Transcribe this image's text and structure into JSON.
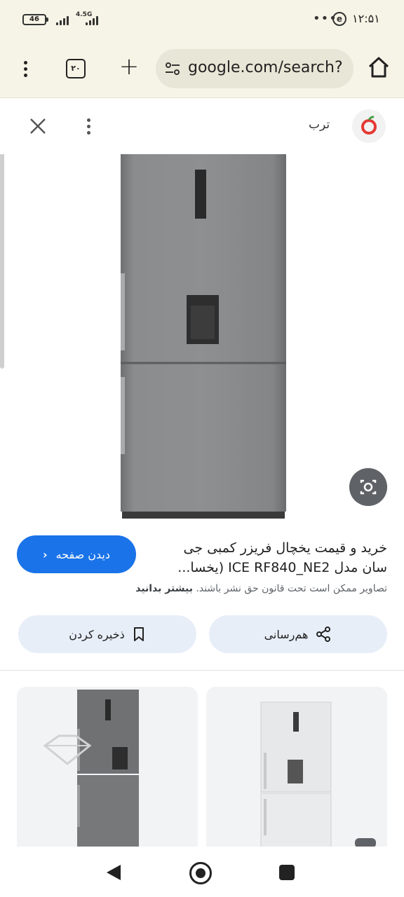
{
  "status_bar": {
    "battery_level": "46",
    "network_type": "4.5G",
    "time": "۱۲:۵۱",
    "overflow_dots": "•••"
  },
  "toolbar": {
    "tab_count": "۲۰",
    "url": "google.com/search?"
  },
  "viewer": {
    "source_name": "ترب"
  },
  "result": {
    "title_line1": "خرید و قیمت یخچال فریزر کمبی جی",
    "title_line2": "سان مدل ICE RF840_NE2 (یخسا...",
    "visit_label": "دیدن صفحه",
    "copyright_text": "تصاویر ممکن است تحت قانون حق نشر باشند.",
    "learn_more": "بیشتر بدانید",
    "share_label": "هم‌رسانی",
    "save_label": "ذخیره کردن"
  },
  "colors": {
    "toolbar_bg": "#f6f4e6",
    "accent": "#1a73e8",
    "action_bg": "#e8eef8"
  },
  "icons": [
    "battery-icon",
    "signal-icon",
    "menu-icon",
    "tabs-icon",
    "plus-icon",
    "tune-icon",
    "home-icon",
    "close-icon",
    "more-vert-icon",
    "torob-logo-icon",
    "lens-icon",
    "chevron-left-icon",
    "share-icon",
    "bookmark-icon",
    "back-icon",
    "home-circle-icon",
    "recents-icon"
  ]
}
